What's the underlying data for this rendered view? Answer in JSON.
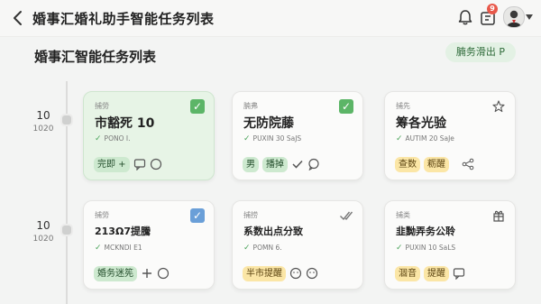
{
  "header": {
    "title": "婚事汇婚礼助手智能任务列表",
    "notification_count": "9"
  },
  "main": {
    "heading": "婚事汇智能任务列表",
    "top_pill": "腩务滑出 P"
  },
  "timeline": [
    {
      "line1": "10",
      "line2": "1020"
    },
    {
      "line1": "10",
      "line2": "1020"
    }
  ],
  "cards": [
    {
      "category": "捕勞",
      "title": "市豁死 10",
      "subtitle": "PONO I.",
      "tags": [
        "完即 +"
      ],
      "checked": true
    },
    {
      "category": "腩弗",
      "title": "无防院藤",
      "subtitle": "PUXIN 30 SaJS",
      "tags": [
        "男",
        "播掉"
      ],
      "checked": true
    },
    {
      "category": "捕先",
      "title": "筹各光验",
      "subtitle": "AUTIM 20 SaJe",
      "tags": [
        "查数",
        "粝醒"
      ],
      "checked": false
    },
    {
      "category": "捕勞",
      "title": "213Ω7提騰",
      "subtitle": "MCKNDI E1",
      "tags": [
        "婚务迷筅"
      ],
      "checked": true
    },
    {
      "category": "捕捞",
      "title": "系数出点分致",
      "subtitle": "POMN 6.",
      "tags": [
        "半市提醒"
      ],
      "checked": false
    },
    {
      "category": "捕类",
      "title": "韭黝弄务公聆",
      "subtitle": "PUXIN 10 SaLS",
      "tags": [
        "涸音",
        "提醒"
      ],
      "checked": false
    }
  ],
  "colors": {
    "accent_green": "#5cb567",
    "tag_green": "#cde9cf",
    "tag_yellow": "#fbe6a6",
    "check_blue": "#6a9fd8",
    "badge_red": "#e8584a"
  }
}
